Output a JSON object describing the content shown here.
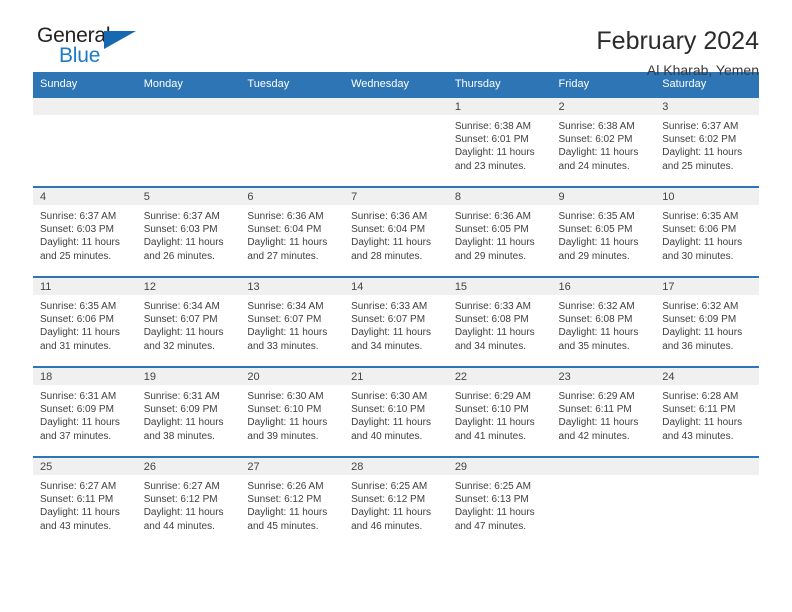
{
  "brand": {
    "name_part1": "General",
    "name_part2": "Blue"
  },
  "header": {
    "title": "February 2024",
    "location": "Al Kharab, Yemen"
  },
  "colors": {
    "header_blue": "#2E75B6",
    "brand_blue": "#1E7BC4",
    "daynum_band": "#F0F0F0"
  },
  "weekdays": [
    "Sunday",
    "Monday",
    "Tuesday",
    "Wednesday",
    "Thursday",
    "Friday",
    "Saturday"
  ],
  "weeks": [
    [
      {
        "day": "",
        "sunrise": "",
        "sunset": "",
        "daylight1": "",
        "daylight2": ""
      },
      {
        "day": "",
        "sunrise": "",
        "sunset": "",
        "daylight1": "",
        "daylight2": ""
      },
      {
        "day": "",
        "sunrise": "",
        "sunset": "",
        "daylight1": "",
        "daylight2": ""
      },
      {
        "day": "",
        "sunrise": "",
        "sunset": "",
        "daylight1": "",
        "daylight2": ""
      },
      {
        "day": "1",
        "sunrise": "Sunrise: 6:38 AM",
        "sunset": "Sunset: 6:01 PM",
        "daylight1": "Daylight: 11 hours",
        "daylight2": "and 23 minutes."
      },
      {
        "day": "2",
        "sunrise": "Sunrise: 6:38 AM",
        "sunset": "Sunset: 6:02 PM",
        "daylight1": "Daylight: 11 hours",
        "daylight2": "and 24 minutes."
      },
      {
        "day": "3",
        "sunrise": "Sunrise: 6:37 AM",
        "sunset": "Sunset: 6:02 PM",
        "daylight1": "Daylight: 11 hours",
        "daylight2": "and 25 minutes."
      }
    ],
    [
      {
        "day": "4",
        "sunrise": "Sunrise: 6:37 AM",
        "sunset": "Sunset: 6:03 PM",
        "daylight1": "Daylight: 11 hours",
        "daylight2": "and 25 minutes."
      },
      {
        "day": "5",
        "sunrise": "Sunrise: 6:37 AM",
        "sunset": "Sunset: 6:03 PM",
        "daylight1": "Daylight: 11 hours",
        "daylight2": "and 26 minutes."
      },
      {
        "day": "6",
        "sunrise": "Sunrise: 6:36 AM",
        "sunset": "Sunset: 6:04 PM",
        "daylight1": "Daylight: 11 hours",
        "daylight2": "and 27 minutes."
      },
      {
        "day": "7",
        "sunrise": "Sunrise: 6:36 AM",
        "sunset": "Sunset: 6:04 PM",
        "daylight1": "Daylight: 11 hours",
        "daylight2": "and 28 minutes."
      },
      {
        "day": "8",
        "sunrise": "Sunrise: 6:36 AM",
        "sunset": "Sunset: 6:05 PM",
        "daylight1": "Daylight: 11 hours",
        "daylight2": "and 29 minutes."
      },
      {
        "day": "9",
        "sunrise": "Sunrise: 6:35 AM",
        "sunset": "Sunset: 6:05 PM",
        "daylight1": "Daylight: 11 hours",
        "daylight2": "and 29 minutes."
      },
      {
        "day": "10",
        "sunrise": "Sunrise: 6:35 AM",
        "sunset": "Sunset: 6:06 PM",
        "daylight1": "Daylight: 11 hours",
        "daylight2": "and 30 minutes."
      }
    ],
    [
      {
        "day": "11",
        "sunrise": "Sunrise: 6:35 AM",
        "sunset": "Sunset: 6:06 PM",
        "daylight1": "Daylight: 11 hours",
        "daylight2": "and 31 minutes."
      },
      {
        "day": "12",
        "sunrise": "Sunrise: 6:34 AM",
        "sunset": "Sunset: 6:07 PM",
        "daylight1": "Daylight: 11 hours",
        "daylight2": "and 32 minutes."
      },
      {
        "day": "13",
        "sunrise": "Sunrise: 6:34 AM",
        "sunset": "Sunset: 6:07 PM",
        "daylight1": "Daylight: 11 hours",
        "daylight2": "and 33 minutes."
      },
      {
        "day": "14",
        "sunrise": "Sunrise: 6:33 AM",
        "sunset": "Sunset: 6:07 PM",
        "daylight1": "Daylight: 11 hours",
        "daylight2": "and 34 minutes."
      },
      {
        "day": "15",
        "sunrise": "Sunrise: 6:33 AM",
        "sunset": "Sunset: 6:08 PM",
        "daylight1": "Daylight: 11 hours",
        "daylight2": "and 34 minutes."
      },
      {
        "day": "16",
        "sunrise": "Sunrise: 6:32 AM",
        "sunset": "Sunset: 6:08 PM",
        "daylight1": "Daylight: 11 hours",
        "daylight2": "and 35 minutes."
      },
      {
        "day": "17",
        "sunrise": "Sunrise: 6:32 AM",
        "sunset": "Sunset: 6:09 PM",
        "daylight1": "Daylight: 11 hours",
        "daylight2": "and 36 minutes."
      }
    ],
    [
      {
        "day": "18",
        "sunrise": "Sunrise: 6:31 AM",
        "sunset": "Sunset: 6:09 PM",
        "daylight1": "Daylight: 11 hours",
        "daylight2": "and 37 minutes."
      },
      {
        "day": "19",
        "sunrise": "Sunrise: 6:31 AM",
        "sunset": "Sunset: 6:09 PM",
        "daylight1": "Daylight: 11 hours",
        "daylight2": "and 38 minutes."
      },
      {
        "day": "20",
        "sunrise": "Sunrise: 6:30 AM",
        "sunset": "Sunset: 6:10 PM",
        "daylight1": "Daylight: 11 hours",
        "daylight2": "and 39 minutes."
      },
      {
        "day": "21",
        "sunrise": "Sunrise: 6:30 AM",
        "sunset": "Sunset: 6:10 PM",
        "daylight1": "Daylight: 11 hours",
        "daylight2": "and 40 minutes."
      },
      {
        "day": "22",
        "sunrise": "Sunrise: 6:29 AM",
        "sunset": "Sunset: 6:10 PM",
        "daylight1": "Daylight: 11 hours",
        "daylight2": "and 41 minutes."
      },
      {
        "day": "23",
        "sunrise": "Sunrise: 6:29 AM",
        "sunset": "Sunset: 6:11 PM",
        "daylight1": "Daylight: 11 hours",
        "daylight2": "and 42 minutes."
      },
      {
        "day": "24",
        "sunrise": "Sunrise: 6:28 AM",
        "sunset": "Sunset: 6:11 PM",
        "daylight1": "Daylight: 11 hours",
        "daylight2": "and 43 minutes."
      }
    ],
    [
      {
        "day": "25",
        "sunrise": "Sunrise: 6:27 AM",
        "sunset": "Sunset: 6:11 PM",
        "daylight1": "Daylight: 11 hours",
        "daylight2": "and 43 minutes."
      },
      {
        "day": "26",
        "sunrise": "Sunrise: 6:27 AM",
        "sunset": "Sunset: 6:12 PM",
        "daylight1": "Daylight: 11 hours",
        "daylight2": "and 44 minutes."
      },
      {
        "day": "27",
        "sunrise": "Sunrise: 6:26 AM",
        "sunset": "Sunset: 6:12 PM",
        "daylight1": "Daylight: 11 hours",
        "daylight2": "and 45 minutes."
      },
      {
        "day": "28",
        "sunrise": "Sunrise: 6:25 AM",
        "sunset": "Sunset: 6:12 PM",
        "daylight1": "Daylight: 11 hours",
        "daylight2": "and 46 minutes."
      },
      {
        "day": "29",
        "sunrise": "Sunrise: 6:25 AM",
        "sunset": "Sunset: 6:13 PM",
        "daylight1": "Daylight: 11 hours",
        "daylight2": "and 47 minutes."
      },
      {
        "day": "",
        "sunrise": "",
        "sunset": "",
        "daylight1": "",
        "daylight2": ""
      },
      {
        "day": "",
        "sunrise": "",
        "sunset": "",
        "daylight1": "",
        "daylight2": ""
      }
    ]
  ]
}
